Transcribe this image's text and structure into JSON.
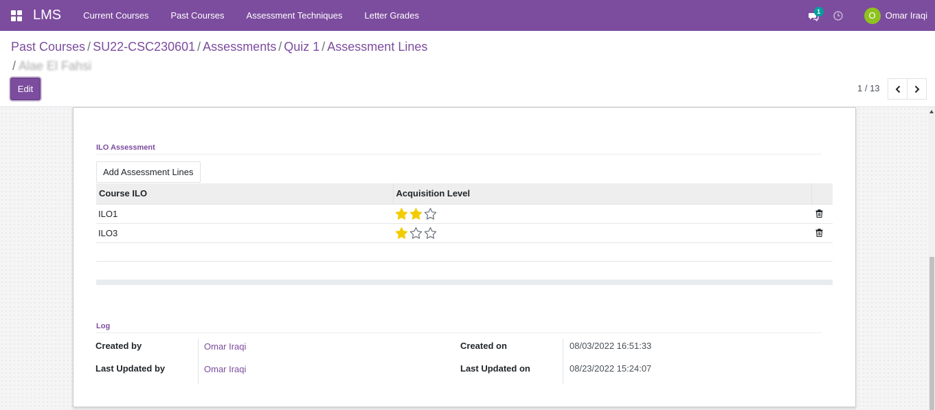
{
  "navbar": {
    "brand": "LMS",
    "menu": [
      "Current Courses",
      "Past Courses",
      "Assessment Techniques",
      "Letter Grades"
    ],
    "messages_count": "1",
    "user_initial": "O",
    "user_name": "Omar Iraqi",
    "bg_color": "#7C4C9E"
  },
  "breadcrumb": {
    "items": [
      "Past Courses",
      "SU22-CSC230601",
      "Assessments",
      "Quiz 1",
      "Assessment Lines"
    ],
    "current": "Alae El Fahsi",
    "separator": "/"
  },
  "toolbar": {
    "edit_label": "Edit",
    "pager": "1 / 13"
  },
  "ilo_section": {
    "title": "ILO Assessment",
    "add_button": "Add Assessment Lines",
    "columns": [
      "Course ILO",
      "Acquisition Level"
    ],
    "rows": [
      {
        "ilo": "ILO1",
        "level": 2,
        "max": 3
      },
      {
        "ilo": "ILO3",
        "level": 1,
        "max": 3
      }
    ]
  },
  "log_section": {
    "title": "Log",
    "created_by_label": "Created by",
    "created_by": "Omar Iraqi",
    "updated_by_label": "Last Updated by",
    "updated_by": "Omar Iraqi",
    "created_on_label": "Created on",
    "created_on": "08/03/2022 16:51:33",
    "updated_on_label": "Last Updated on",
    "updated_on": "08/23/2022 15:24:07"
  },
  "colors": {
    "primary": "#7C4C9E",
    "star_filled": "#F3CC00",
    "star_empty": "#6c757d",
    "avatar": "#8EC21F",
    "badge": "#00A09D"
  }
}
